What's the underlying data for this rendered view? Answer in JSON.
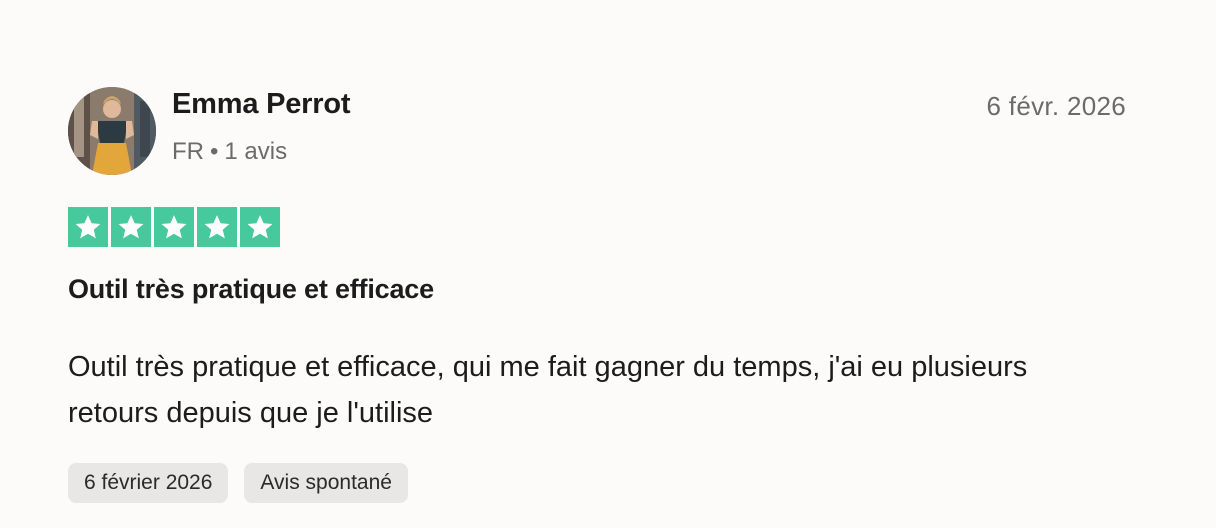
{
  "review": {
    "author": {
      "name": "Emma Perrot",
      "country": "FR",
      "separator": "•",
      "review_count": "1 avis"
    },
    "date": "6 févr. 2026",
    "rating": 5,
    "star_color": "#00b67a",
    "star_icon": "star-icon",
    "title": "Outil très pratique et efficace",
    "text": "Outil très pratique et efficace, qui me fait gagner du temps, j'ai eu plusieurs retours depuis que je l'utilise",
    "tags": {
      "date_of_experience": "6 février 2026",
      "type": "Avis spontané"
    }
  }
}
